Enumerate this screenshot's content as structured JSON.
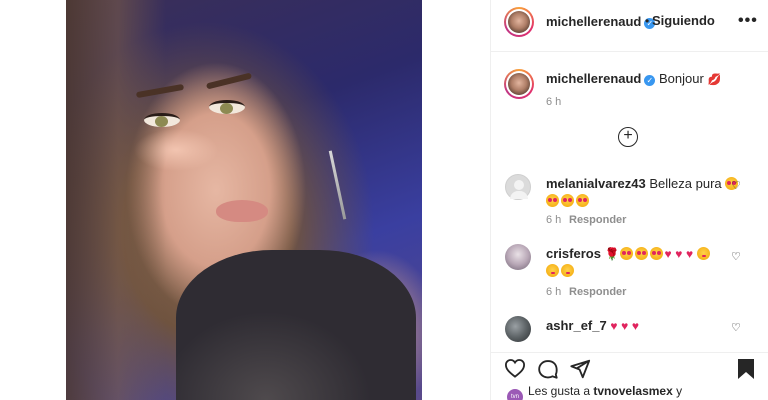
{
  "post": {
    "author": "michellerenaud",
    "follow_separator": "•",
    "follow_label": "Siguiendo",
    "caption": "Bonjour",
    "caption_emoji": "kiss-lips",
    "caption_time": "6 h"
  },
  "comments": [
    {
      "user": "melanialvarez43",
      "text": "Belleza pura",
      "emojis_line1": [
        "star-struck"
      ],
      "emojis_line2": [
        "star-struck",
        "star-struck",
        "star-struck"
      ],
      "time": "6 h",
      "reply_label": "Responder"
    },
    {
      "user": "crisferos",
      "emojis_line1": [
        "rose",
        "star-struck",
        "star-struck",
        "star-struck",
        "heart",
        "heart",
        "heart",
        "wink"
      ],
      "emojis_line2": [
        "wink",
        "wink"
      ],
      "time": "6 h",
      "reply_label": "Responder"
    },
    {
      "user": "ashr_ef_7",
      "emojis_line1": [
        "heart",
        "heart",
        "heart"
      ]
    }
  ],
  "likes": {
    "prefix": "Les gusta a",
    "user": "tvnovelasmex",
    "suffix": "y"
  },
  "icons": {
    "verified": "check",
    "more": "•••",
    "plus": "+",
    "heart": "♡",
    "red_heart": "♥",
    "rose": "🌹",
    "kiss": "💋"
  },
  "colors": {
    "verified_blue": "#3897f0",
    "heart_red": "#e0245e",
    "text": "#262626",
    "muted": "#8e8e8e"
  }
}
